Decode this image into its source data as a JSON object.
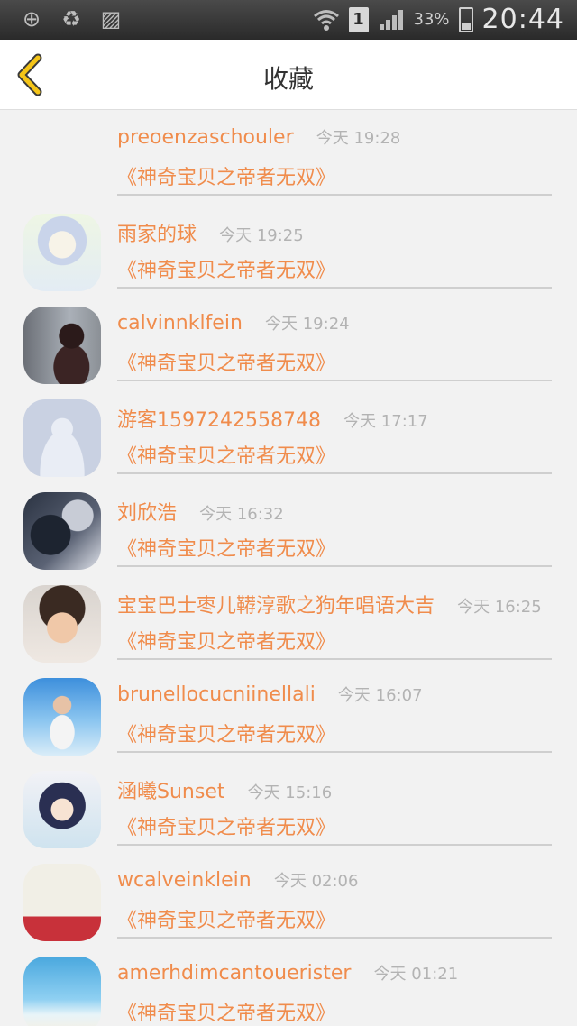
{
  "status_bar": {
    "icons": [
      "add-circle-icon",
      "battery-saver-icon",
      "image-icon",
      "wifi-icon",
      "sim-icon",
      "signal-icon",
      "battery-icon"
    ],
    "sim_label": "1",
    "battery_percent": "33%",
    "time": "20:44"
  },
  "header": {
    "title": "收藏",
    "back_icon": "chevron-left-icon"
  },
  "colors": {
    "accent": "#f08c4c",
    "back_icon": "#f5c518",
    "time_text": "#b3b3b3"
  },
  "items": [
    {
      "username": "preoenzaschouler",
      "time": "今天 19:28",
      "title": "《神奇宝贝之帝者无双》",
      "avatar": "none"
    },
    {
      "username": "雨家的球",
      "time": "今天 19:25",
      "title": "《神奇宝贝之帝者无双》",
      "avatar": "anime-girl-pastel"
    },
    {
      "username": "calvinnklfein",
      "time": "今天 19:24",
      "title": "《神奇宝贝之帝者无双》",
      "avatar": "photo-dark"
    },
    {
      "username": "游客1597242558748",
      "time": "今天 17:17",
      "title": "《神奇宝贝之帝者无双》",
      "avatar": "default-silhouette"
    },
    {
      "username": "刘欣浩",
      "time": "今天 16:32",
      "title": "《神奇宝贝之帝者无双》",
      "avatar": "photo-blue-dark"
    },
    {
      "username": "宝宝巴士枣儿鞯淳歌之狗年唱语大吉",
      "time": "今天 16:25",
      "title": "《神奇宝贝之帝者无双》",
      "avatar": "child-photo"
    },
    {
      "username": "brunellocucniinellali",
      "time": "今天 16:07",
      "title": "《神奇宝贝之帝者无双》",
      "avatar": "beach-photo"
    },
    {
      "username": "涵曦Sunset",
      "time": "今天 15:16",
      "title": "《神奇宝贝之帝者无双》",
      "avatar": "anime-girl-dark"
    },
    {
      "username": "wcalveinklein",
      "time": "今天 02:06",
      "title": "《神奇宝贝之帝者无双》",
      "avatar": "photo-light-red"
    },
    {
      "username": "amerhdimcantouerister",
      "time": "今天 01:21",
      "title": "《神奇宝贝之帝者无双》",
      "avatar": "sea-photo"
    }
  ]
}
